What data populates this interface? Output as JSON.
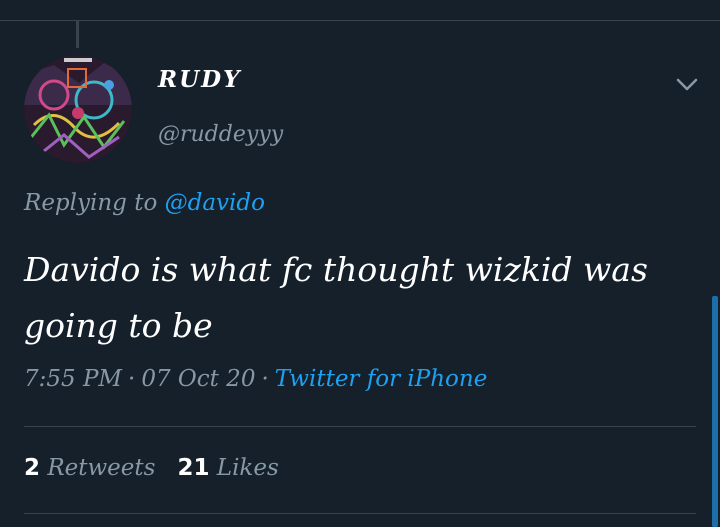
{
  "tweet": {
    "author": {
      "display_name": "RUDY",
      "handle": "@ruddeyyy",
      "avatar_icon": "avatar-artwork"
    },
    "replying_prefix": "Replying to",
    "replying_to": "@davido",
    "text": "Davido is what fc thought wizkid was going to be",
    "meta": {
      "time": "7:55 PM",
      "separator": "·",
      "date": "07 Oct 20",
      "source": "Twitter for iPhone"
    },
    "stats": {
      "retweets_count": "2",
      "retweets_label": "Retweets",
      "likes_count": "21",
      "likes_label": "Likes"
    }
  },
  "icons": {
    "menu": "chevron-down-icon"
  },
  "colors": {
    "background": "#15202b",
    "accent": "#1da1f2",
    "secondary_text": "#8899a6",
    "divider": "#38444d"
  }
}
